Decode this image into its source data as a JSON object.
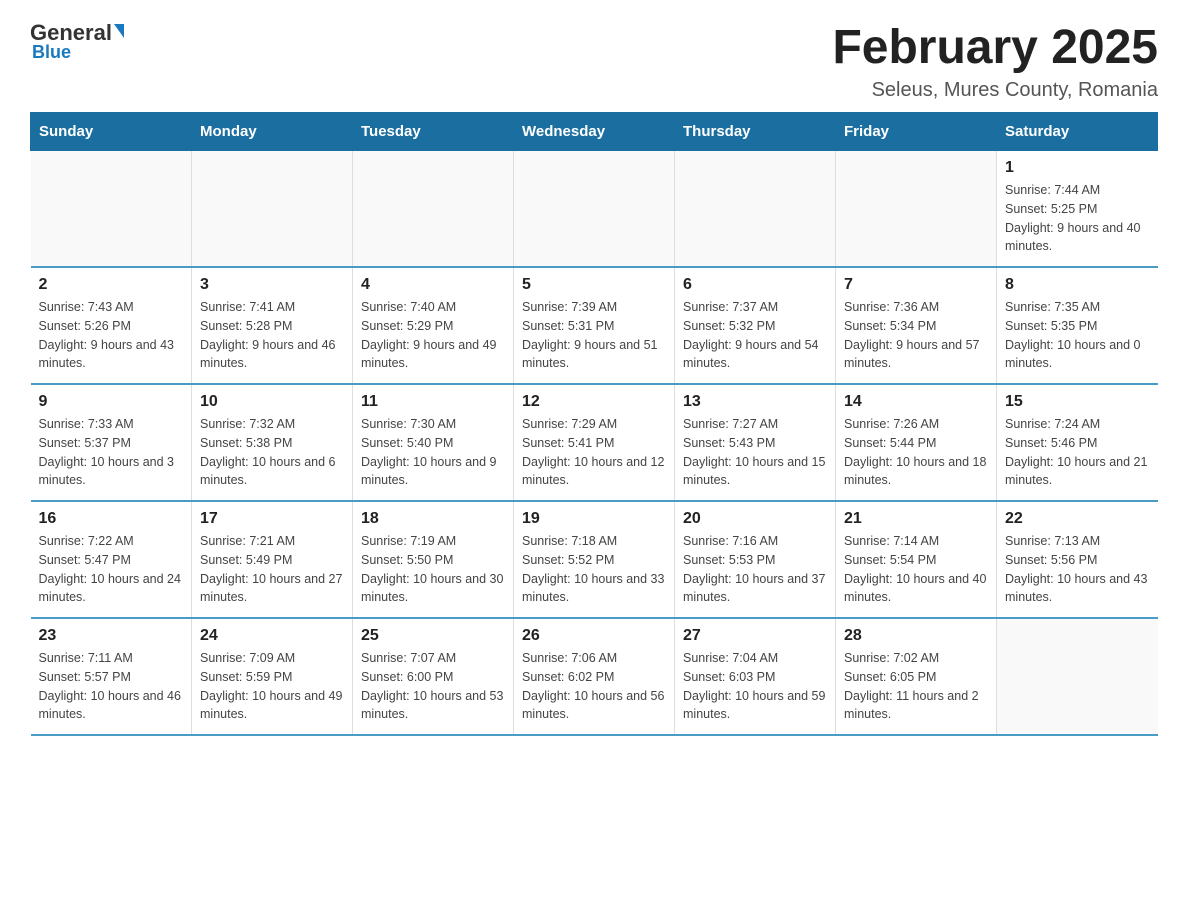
{
  "logo": {
    "general": "General",
    "blue": "Blue"
  },
  "title": "February 2025",
  "subtitle": "Seleus, Mures County, Romania",
  "weekdays": [
    "Sunday",
    "Monday",
    "Tuesday",
    "Wednesday",
    "Thursday",
    "Friday",
    "Saturday"
  ],
  "weeks": [
    [
      {
        "day": "",
        "info": ""
      },
      {
        "day": "",
        "info": ""
      },
      {
        "day": "",
        "info": ""
      },
      {
        "day": "",
        "info": ""
      },
      {
        "day": "",
        "info": ""
      },
      {
        "day": "",
        "info": ""
      },
      {
        "day": "1",
        "info": "Sunrise: 7:44 AM\nSunset: 5:25 PM\nDaylight: 9 hours and 40 minutes."
      }
    ],
    [
      {
        "day": "2",
        "info": "Sunrise: 7:43 AM\nSunset: 5:26 PM\nDaylight: 9 hours and 43 minutes."
      },
      {
        "day": "3",
        "info": "Sunrise: 7:41 AM\nSunset: 5:28 PM\nDaylight: 9 hours and 46 minutes."
      },
      {
        "day": "4",
        "info": "Sunrise: 7:40 AM\nSunset: 5:29 PM\nDaylight: 9 hours and 49 minutes."
      },
      {
        "day": "5",
        "info": "Sunrise: 7:39 AM\nSunset: 5:31 PM\nDaylight: 9 hours and 51 minutes."
      },
      {
        "day": "6",
        "info": "Sunrise: 7:37 AM\nSunset: 5:32 PM\nDaylight: 9 hours and 54 minutes."
      },
      {
        "day": "7",
        "info": "Sunrise: 7:36 AM\nSunset: 5:34 PM\nDaylight: 9 hours and 57 minutes."
      },
      {
        "day": "8",
        "info": "Sunrise: 7:35 AM\nSunset: 5:35 PM\nDaylight: 10 hours and 0 minutes."
      }
    ],
    [
      {
        "day": "9",
        "info": "Sunrise: 7:33 AM\nSunset: 5:37 PM\nDaylight: 10 hours and 3 minutes."
      },
      {
        "day": "10",
        "info": "Sunrise: 7:32 AM\nSunset: 5:38 PM\nDaylight: 10 hours and 6 minutes."
      },
      {
        "day": "11",
        "info": "Sunrise: 7:30 AM\nSunset: 5:40 PM\nDaylight: 10 hours and 9 minutes."
      },
      {
        "day": "12",
        "info": "Sunrise: 7:29 AM\nSunset: 5:41 PM\nDaylight: 10 hours and 12 minutes."
      },
      {
        "day": "13",
        "info": "Sunrise: 7:27 AM\nSunset: 5:43 PM\nDaylight: 10 hours and 15 minutes."
      },
      {
        "day": "14",
        "info": "Sunrise: 7:26 AM\nSunset: 5:44 PM\nDaylight: 10 hours and 18 minutes."
      },
      {
        "day": "15",
        "info": "Sunrise: 7:24 AM\nSunset: 5:46 PM\nDaylight: 10 hours and 21 minutes."
      }
    ],
    [
      {
        "day": "16",
        "info": "Sunrise: 7:22 AM\nSunset: 5:47 PM\nDaylight: 10 hours and 24 minutes."
      },
      {
        "day": "17",
        "info": "Sunrise: 7:21 AM\nSunset: 5:49 PM\nDaylight: 10 hours and 27 minutes."
      },
      {
        "day": "18",
        "info": "Sunrise: 7:19 AM\nSunset: 5:50 PM\nDaylight: 10 hours and 30 minutes."
      },
      {
        "day": "19",
        "info": "Sunrise: 7:18 AM\nSunset: 5:52 PM\nDaylight: 10 hours and 33 minutes."
      },
      {
        "day": "20",
        "info": "Sunrise: 7:16 AM\nSunset: 5:53 PM\nDaylight: 10 hours and 37 minutes."
      },
      {
        "day": "21",
        "info": "Sunrise: 7:14 AM\nSunset: 5:54 PM\nDaylight: 10 hours and 40 minutes."
      },
      {
        "day": "22",
        "info": "Sunrise: 7:13 AM\nSunset: 5:56 PM\nDaylight: 10 hours and 43 minutes."
      }
    ],
    [
      {
        "day": "23",
        "info": "Sunrise: 7:11 AM\nSunset: 5:57 PM\nDaylight: 10 hours and 46 minutes."
      },
      {
        "day": "24",
        "info": "Sunrise: 7:09 AM\nSunset: 5:59 PM\nDaylight: 10 hours and 49 minutes."
      },
      {
        "day": "25",
        "info": "Sunrise: 7:07 AM\nSunset: 6:00 PM\nDaylight: 10 hours and 53 minutes."
      },
      {
        "day": "26",
        "info": "Sunrise: 7:06 AM\nSunset: 6:02 PM\nDaylight: 10 hours and 56 minutes."
      },
      {
        "day": "27",
        "info": "Sunrise: 7:04 AM\nSunset: 6:03 PM\nDaylight: 10 hours and 59 minutes."
      },
      {
        "day": "28",
        "info": "Sunrise: 7:02 AM\nSunset: 6:05 PM\nDaylight: 11 hours and 2 minutes."
      },
      {
        "day": "",
        "info": ""
      }
    ]
  ]
}
